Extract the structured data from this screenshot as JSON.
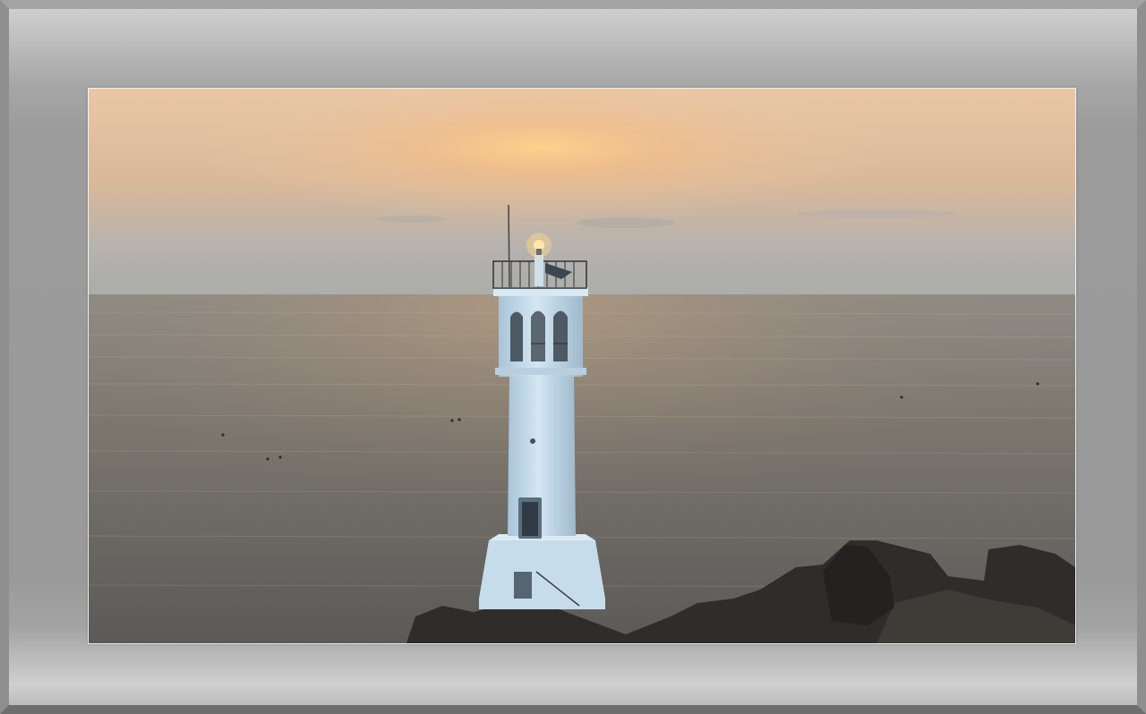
{
  "scene": {
    "subject": "lighthouse-at-sunset",
    "palette": {
      "sky_top": "#e6c8a8",
      "sun_glow": "#ffcf8a",
      "haze": "#b8b4b0",
      "sea": "#75726c",
      "tower": "#cfe3f0",
      "rocks": "#2e2c29"
    }
  }
}
